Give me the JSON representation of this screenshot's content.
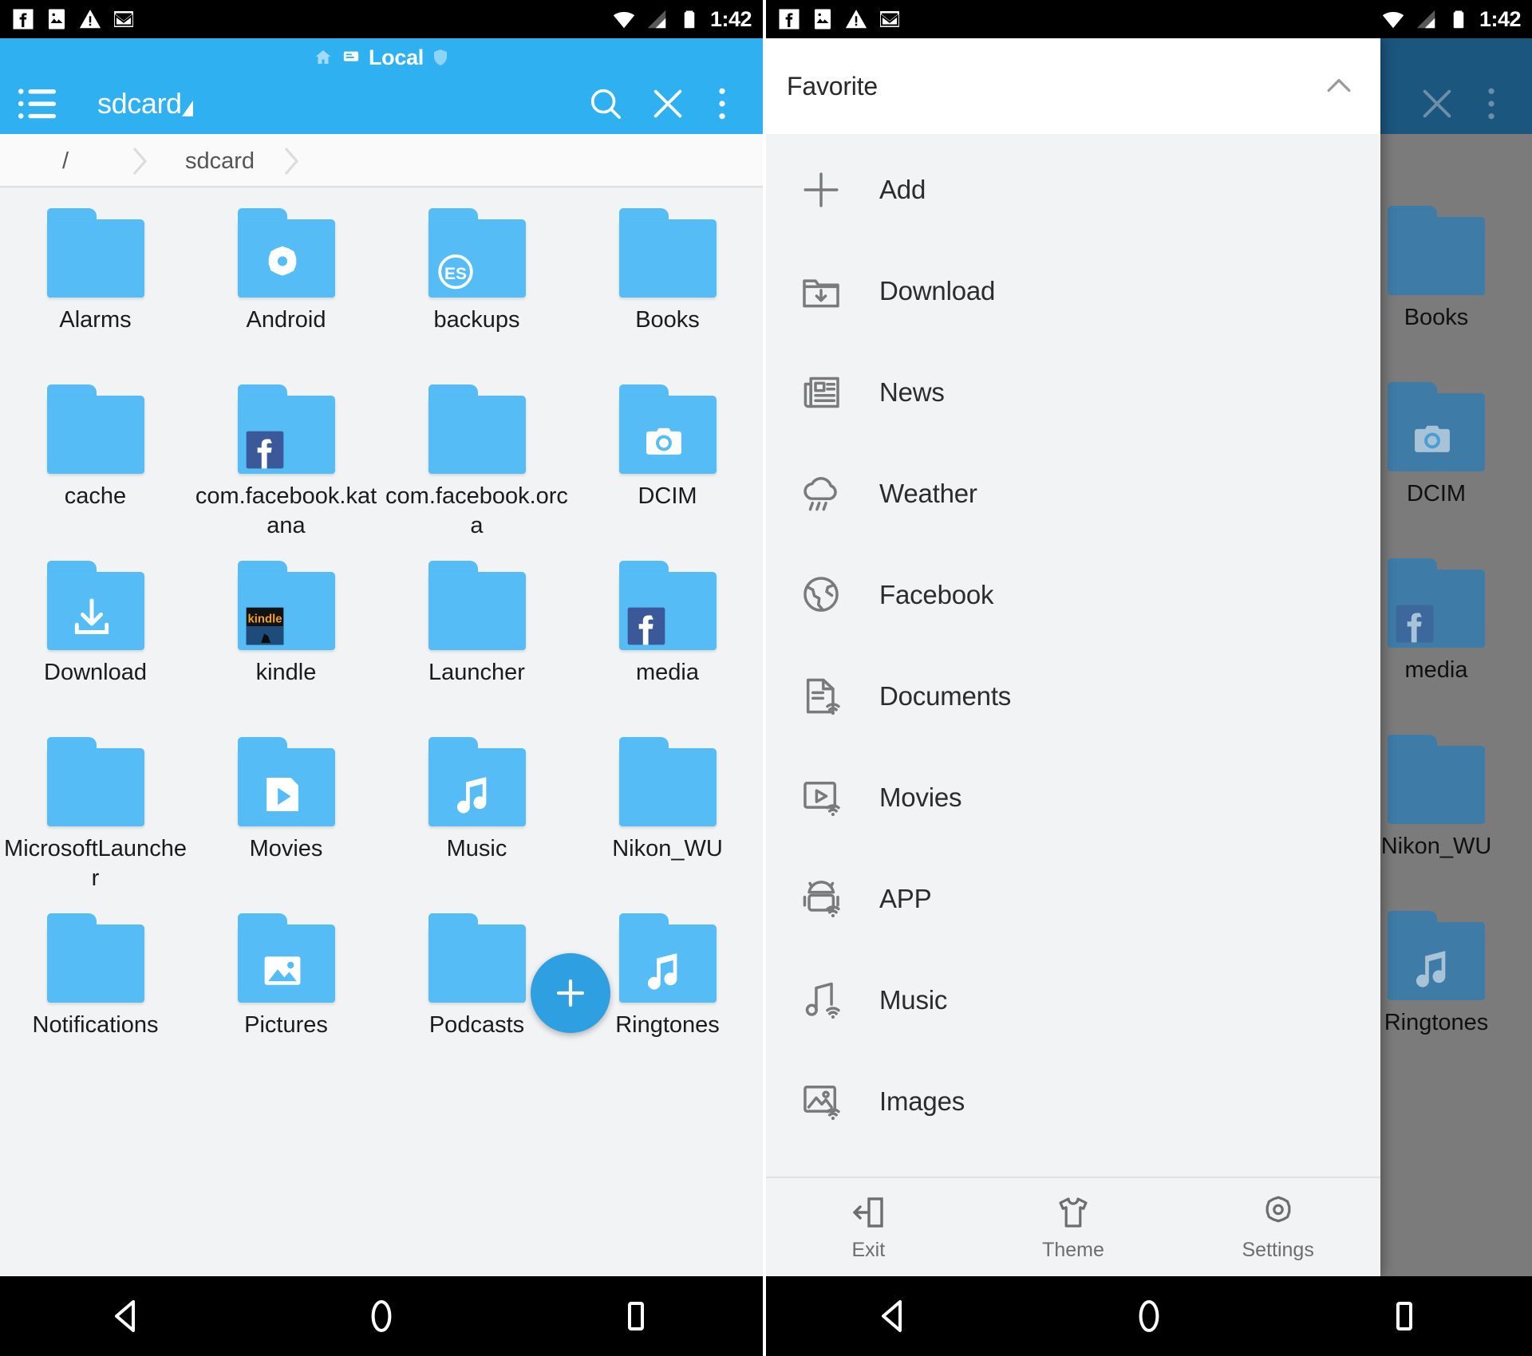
{
  "status_bar": {
    "time": "1:42",
    "left_icons": [
      "facebook-icon",
      "photo-icon",
      "warning-icon",
      "gmail-icon"
    ],
    "right_icons": [
      "wifi-icon",
      "signal-icon",
      "battery-icon"
    ]
  },
  "toolbar": {
    "local_label": "Local",
    "title": "sdcard",
    "menu_icon": "hamburger-list-icon",
    "search_icon": "search-icon",
    "close_icon": "close-icon",
    "overflow_icon": "more-vertical-icon",
    "accent_color": "#2FB0F0"
  },
  "breadcrumb": {
    "items": [
      "/",
      "sdcard"
    ]
  },
  "files": {
    "rows": [
      [
        {
          "name": "Alarms",
          "badge": "none"
        },
        {
          "name": "Android",
          "badge": "gear-icon"
        },
        {
          "name": "backups",
          "badge": "es-logo-icon"
        },
        {
          "name": "Books",
          "badge": "none"
        }
      ],
      [
        {
          "name": "cache",
          "badge": "none"
        },
        {
          "name": "com.facebook.katana",
          "badge": "facebook-icon"
        },
        {
          "name": "com.facebook.orca",
          "badge": "none"
        },
        {
          "name": "DCIM",
          "badge": "camera-icon"
        }
      ],
      [
        {
          "name": "Download",
          "badge": "download-arrow-icon"
        },
        {
          "name": "kindle",
          "badge": "kindle-icon"
        },
        {
          "name": "Launcher",
          "badge": "none"
        },
        {
          "name": "media",
          "badge": "facebook-icon"
        }
      ],
      [
        {
          "name": "MicrosoftLauncher",
          "badge": "none"
        },
        {
          "name": "Movies",
          "badge": "play-icon"
        },
        {
          "name": "Music",
          "badge": "music-note-icon"
        },
        {
          "name": "Nikon_WU",
          "badge": "none"
        }
      ],
      [
        {
          "name": "Notifications",
          "badge": "none"
        },
        {
          "name": "Pictures",
          "badge": "image-icon"
        },
        {
          "name": "Podcasts",
          "badge": "none"
        },
        {
          "name": "Ringtones",
          "badge": "music-note-icon"
        }
      ]
    ]
  },
  "fab": {
    "icon": "plus-icon",
    "color": "#2E9FE0"
  },
  "drawer": {
    "header": {
      "title": "Favorite",
      "collapse_icon": "chevron-up-icon"
    },
    "items": [
      {
        "label": "Add",
        "icon": "plus-icon"
      },
      {
        "label": "Download",
        "icon": "download-folder-icon"
      },
      {
        "label": "News",
        "icon": "newspaper-icon"
      },
      {
        "label": "Weather",
        "icon": "rain-cloud-icon"
      },
      {
        "label": "Facebook",
        "icon": "globe-icon"
      },
      {
        "label": "Documents",
        "icon": "document-network-icon"
      },
      {
        "label": "Movies",
        "icon": "movie-network-icon"
      },
      {
        "label": "APP",
        "icon": "android-network-icon"
      },
      {
        "label": "Music",
        "icon": "music-network-icon"
      },
      {
        "label": "Images",
        "icon": "image-network-icon"
      }
    ],
    "footer": [
      {
        "label": "Exit",
        "icon": "exit-icon"
      },
      {
        "label": "Theme",
        "icon": "tshirt-icon"
      },
      {
        "label": "Settings",
        "icon": "gear-icon"
      }
    ]
  },
  "navbar": {
    "back": "back-triangle-icon",
    "home": "home-circle-icon",
    "recents": "recents-square-icon"
  }
}
